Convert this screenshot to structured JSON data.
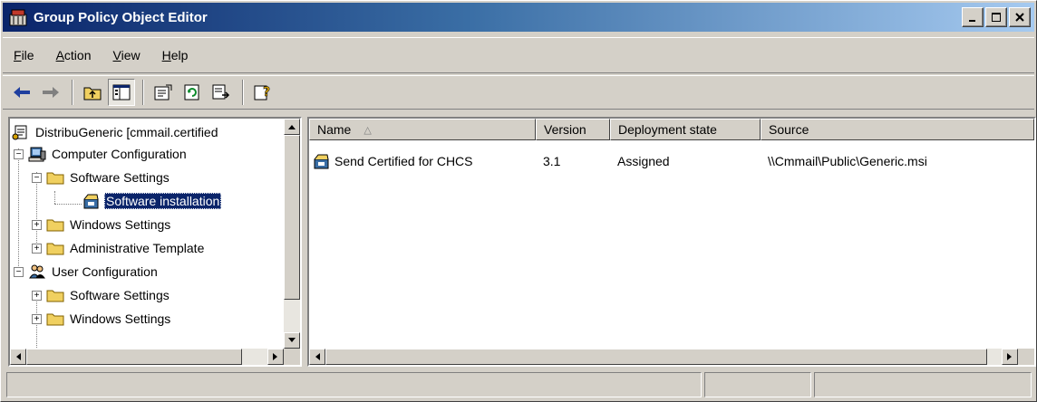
{
  "window": {
    "title": "Group Policy Object Editor"
  },
  "menu": {
    "items": [
      {
        "label_underlined": "F",
        "label_rest": "ile"
      },
      {
        "label_underlined": "A",
        "label_rest": "ction"
      },
      {
        "label_underlined": "V",
        "label_rest": "iew"
      },
      {
        "label_underlined": "H",
        "label_rest": "elp"
      }
    ]
  },
  "tree": {
    "root": "DistribuGeneric [cmmail.certified",
    "computer_config": "Computer Configuration",
    "cc_software_settings": "Software Settings",
    "software_installation": "Software installation",
    "cc_windows_settings": "Windows Settings",
    "cc_admin_templates": "Administrative Template",
    "user_config": "User Configuration",
    "uc_software_settings": "Software Settings",
    "uc_windows_settings": "Windows Settings"
  },
  "list": {
    "columns": {
      "name": "Name",
      "version": "Version",
      "deployment": "Deployment state",
      "source": "Source"
    },
    "rows": [
      {
        "name": "Send Certified for CHCS",
        "version": "3.1",
        "deployment": "Assigned",
        "source": "\\\\Cmmail\\Public\\Generic.msi"
      }
    ]
  }
}
